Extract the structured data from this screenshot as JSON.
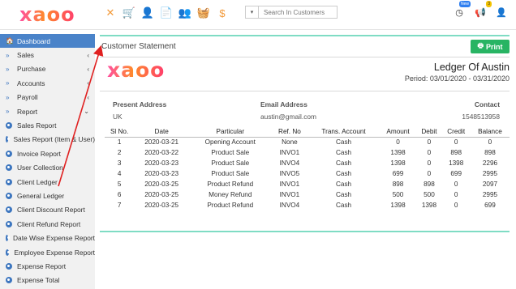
{
  "app": {
    "logo": "xaoo",
    "search_placeholder": "Search In Customers",
    "badges": {
      "new": "New",
      "alerts": "3"
    }
  },
  "toolbar_icons": [
    "close-icon",
    "cart-icon",
    "add-user-icon",
    "add-doc-icon",
    "users-add-icon",
    "basket-add-icon",
    "dollar-add-icon"
  ],
  "sidebar": {
    "items": [
      {
        "label": "Dashboard",
        "icon": "home-icon",
        "active": true
      },
      {
        "label": "Sales",
        "icon": "chevron-right-icon",
        "caret": "‹"
      },
      {
        "label": "Purchase",
        "icon": "chevron-right-icon",
        "caret": "‹"
      },
      {
        "label": "Accounts",
        "icon": "chevron-right-icon",
        "caret": "‹"
      },
      {
        "label": "Payroll",
        "icon": "chevron-right-icon",
        "caret": "‹"
      },
      {
        "label": "Report",
        "icon": "chevron-right-icon",
        "caret": "⌄"
      },
      {
        "label": "Sales Report",
        "sub": true
      },
      {
        "label": "Sales Report (Item & User)",
        "sub": true
      },
      {
        "label": "Invoice Report",
        "sub": true
      },
      {
        "label": "User Collection",
        "sub": true
      },
      {
        "label": "Client Ledger",
        "sub": true
      },
      {
        "label": "General Ledger",
        "sub": true
      },
      {
        "label": "Client Discount Report",
        "sub": true
      },
      {
        "label": "Client Refund Report",
        "sub": true
      },
      {
        "label": "Date Wise Expense Report",
        "sub": true
      },
      {
        "label": "Employee Expense Report",
        "sub": true
      },
      {
        "label": "Expense Report",
        "sub": true
      },
      {
        "label": "Expense Total",
        "sub": true
      }
    ]
  },
  "main": {
    "title": "Customer Statement",
    "print_label": "Print",
    "ledger_title": "Ledger Of Austin",
    "period": "Period: 03/01/2020 - 03/31/2020",
    "present_address_label": "Present Address",
    "present_address": "UK",
    "email_label": "Email Address",
    "email": "austin@gmail.com",
    "contact_label": "Contact",
    "contact": "1548513958",
    "columns": [
      "Sl No.",
      "Date",
      "Particular",
      "Ref. No",
      "Trans. Account",
      "Amount",
      "Debit",
      "Credit",
      "Balance"
    ],
    "rows": [
      [
        "1",
        "2020-03-21",
        "Opening Account",
        "None",
        "Cash",
        "0",
        "0",
        "0",
        "0"
      ],
      [
        "2",
        "2020-03-22",
        "Product Sale",
        "INVO1",
        "Cash",
        "1398",
        "0",
        "898",
        "898"
      ],
      [
        "3",
        "2020-03-23",
        "Product Sale",
        "INVO4",
        "Cash",
        "1398",
        "0",
        "1398",
        "2296"
      ],
      [
        "4",
        "2020-03-23",
        "Product Sale",
        "INVO5",
        "Cash",
        "699",
        "0",
        "699",
        "2995"
      ],
      [
        "5",
        "2020-03-25",
        "Product Refund",
        "INVO1",
        "Cash",
        "898",
        "898",
        "0",
        "2097"
      ],
      [
        "6",
        "2020-03-25",
        "Money Refund",
        "INVO1",
        "Cash",
        "500",
        "500",
        "0",
        "2995"
      ],
      [
        "7",
        "2020-03-25",
        "Product Refund",
        "INVO4",
        "Cash",
        "1398",
        "1398",
        "0",
        "699"
      ]
    ]
  },
  "colors": {
    "accent": "#4a83c9",
    "print": "#28b463",
    "rule": "#7fdcc4",
    "arrow": "#e02020",
    "toolbar_icon": "#f39a3a"
  }
}
